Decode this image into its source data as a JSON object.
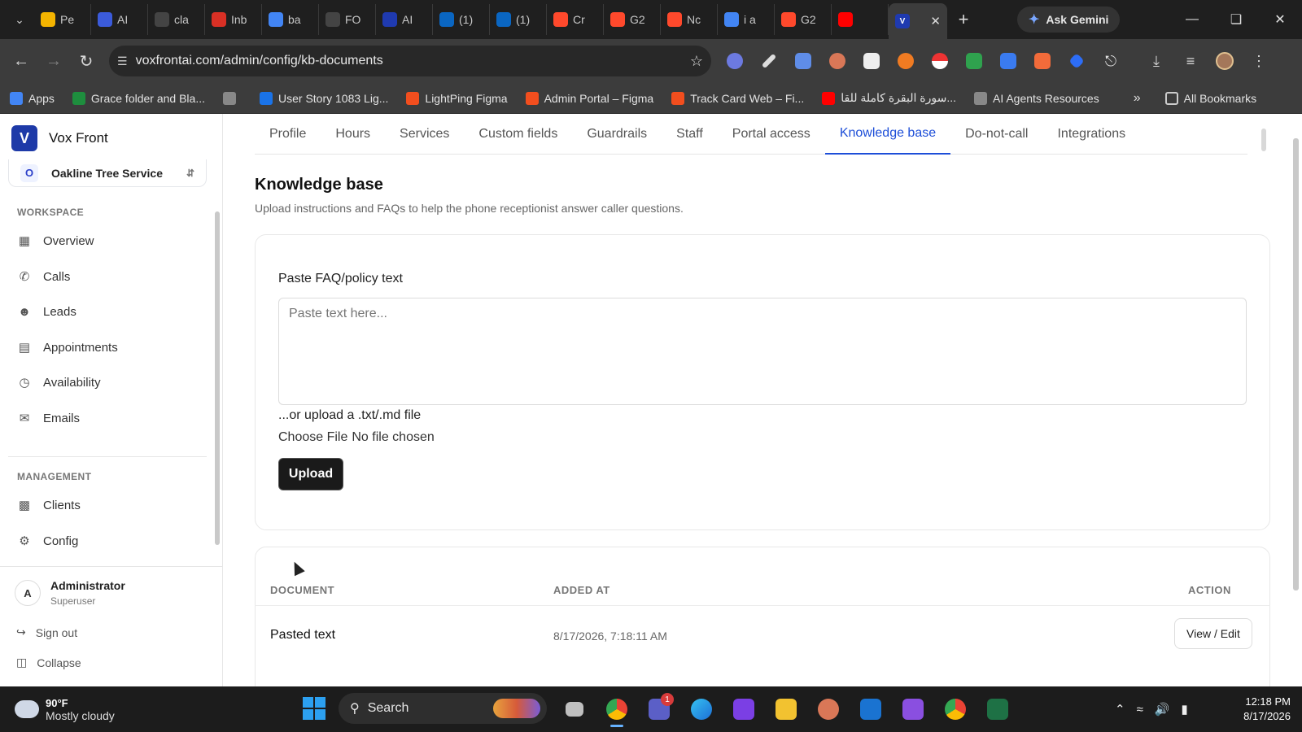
{
  "browser": {
    "tabs": [
      {
        "label": "Pe",
        "color": "#f4b400"
      },
      {
        "label": "AI",
        "color": "#3b5bdb"
      },
      {
        "label": "cla",
        "color": "#444"
      },
      {
        "label": "Inb",
        "color": "#d93025"
      },
      {
        "label": "ba",
        "color": "#4285f4"
      },
      {
        "label": "FO",
        "color": "#444"
      },
      {
        "label": "AI",
        "color": "#1f3ab0"
      },
      {
        "label": "(1)",
        "color": "#0a66c2"
      },
      {
        "label": "(1)",
        "color": "#0a66c2"
      },
      {
        "label": "Cr",
        "color": "#ff492c"
      },
      {
        "label": "G2",
        "color": "#ff492c"
      },
      {
        "label": "Nc",
        "color": "#ff492c"
      },
      {
        "label": "i a",
        "color": "#4285f4"
      },
      {
        "label": "G2",
        "color": "#ff492c"
      },
      {
        "label": "",
        "color": "#ff0000"
      }
    ],
    "ask_gemini": "Ask Gemini",
    "url": "voxfrontai.com/admin/config/kb-documents",
    "bookmarks": [
      {
        "label": "Apps",
        "color": "#4285f4"
      },
      {
        "label": "Grace folder and Bla...",
        "color": "#1e8e3e"
      },
      {
        "label": "",
        "color": "#888"
      },
      {
        "label": "User Story 1083 Lig...",
        "color": "#1a73e8"
      },
      {
        "label": "LightPing Figma",
        "color": "#f24e1e"
      },
      {
        "label": "Admin Portal – Figma",
        "color": "#f24e1e"
      },
      {
        "label": "Track Card Web – Fi...",
        "color": "#f24e1e"
      },
      {
        "label": "سورة البقرة كاملة للقا...",
        "color": "#ff0000"
      },
      {
        "label": "AI Agents Resources",
        "color": "#888"
      }
    ],
    "all_bookmarks": "All Bookmarks"
  },
  "app": {
    "brand": "Vox Front",
    "brand_initial": "V",
    "tenant": {
      "initial": "O",
      "name": "Oakline Tree Service"
    },
    "workspace_label": "WORKSPACE",
    "workspace_items": [
      "Overview",
      "Calls",
      "Leads",
      "Appointments",
      "Availability",
      "Emails"
    ],
    "management_label": "MANAGEMENT",
    "management_items": [
      "Clients",
      "Config"
    ],
    "user": {
      "initial": "A",
      "name": "Administrator",
      "role": "Superuser"
    },
    "sign_out": "Sign out",
    "collapse": "Collapse",
    "tabs": [
      "Profile",
      "Hours",
      "Services",
      "Custom fields",
      "Guardrails",
      "Staff",
      "Portal access",
      "Knowledge base",
      "Do-not-call",
      "Integrations"
    ],
    "active_tab": "Knowledge base",
    "page_title": "Knowledge base",
    "page_subtitle": "Upload instructions and FAQs to help the phone receptionist answer caller questions.",
    "paste_label": "Paste FAQ/policy text",
    "paste_placeholder": "Paste text here...",
    "or_upload": "...or upload a .txt/.md file",
    "choose_file": "Choose File",
    "no_file": "No file chosen",
    "upload_btn": "Upload",
    "table": {
      "headers": {
        "document": "DOCUMENT",
        "added_at": "ADDED AT",
        "action": "ACTION"
      },
      "rows": [
        {
          "document": "Pasted text",
          "added_at": "8/17/2026, 7:18:11 AM",
          "action": "View / Edit"
        }
      ]
    }
  },
  "taskbar": {
    "temp": "90°F",
    "weather": "Mostly cloudy",
    "search": "Search",
    "teams_badge": "1",
    "time": "12:18 PM",
    "date": "8/17/2026"
  }
}
